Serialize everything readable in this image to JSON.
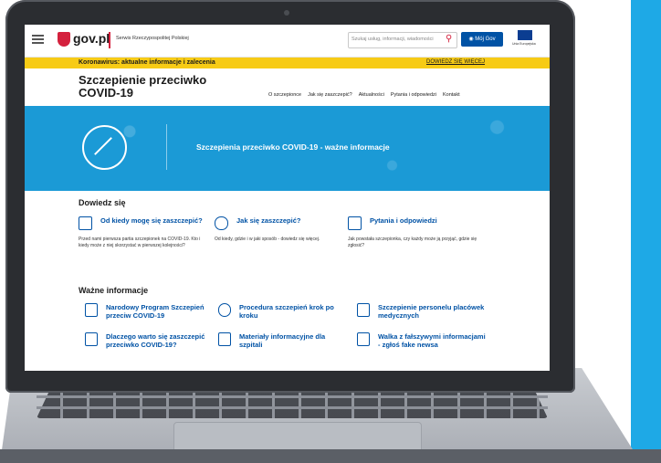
{
  "header": {
    "logo": "gov.pl",
    "service": "Serwis Rzeczypospolitej Polskiej",
    "search_placeholder": "Szukaj usług, informacji, wiadomości",
    "account_button": "Mój Gov",
    "eu_label": "Unia Europejska"
  },
  "banner": {
    "text": "Koronawirus: aktualne informacje i zalecenia",
    "link": "DOWIEDZ SIĘ WIĘCEJ"
  },
  "site": {
    "title": "Szczepienie przeciwko COVID-19",
    "nav": [
      "O szczepionce",
      "Jak się zaszczepić?",
      "Aktualności",
      "Pytania i odpowiedzi",
      "Kontakt"
    ]
  },
  "hero": {
    "text": "Szczepienia przeciwko COVID-19 - ważne informacje"
  },
  "learn": {
    "title": "Dowiedz się",
    "cards": [
      {
        "link": "Od kiedy mogę się zaszczepić?",
        "desc": "Przed nami pierwsza partia szczepionek na COVID-19. Kto i kiedy może z niej skorzystać w pierwszej kolejności?"
      },
      {
        "link": "Jak się zaszczepić?",
        "desc": "Od kiedy, gdzie i w jaki sposób - dowiedz się więcej."
      },
      {
        "link": "Pytania i odpowiedzi",
        "desc": "Jak powstała szczepionka, czy każdy może ją przyjąć, gdzie się zgłosić?"
      }
    ]
  },
  "important": {
    "title": "Ważne informacje",
    "items": [
      "Narodowy Program Szczepień przeciw COVID-19",
      "Procedura szczepień krok po kroku",
      "Szczepienie personelu placówek medycznych",
      "Dlaczego warto się zaszczepić przeciwko COVID-19?",
      "Materiały informacyjne dla szpitali",
      "Walka z fałszywymi informacjami - zgłoś fake newsa"
    ]
  }
}
